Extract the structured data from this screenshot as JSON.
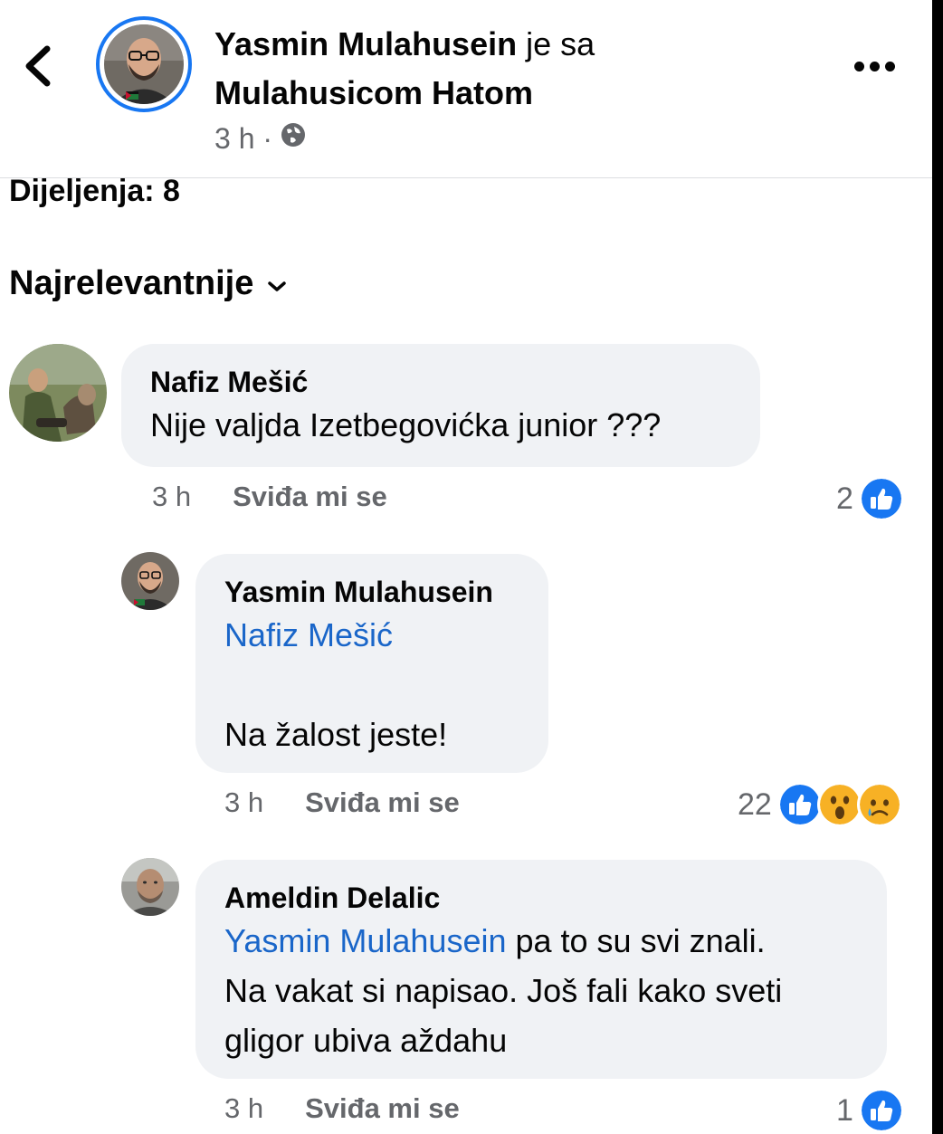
{
  "header": {
    "author": "Yasmin Mulahusein",
    "with_text": "je sa",
    "tagged": "Mulahusicom Hatom",
    "time": "3 h ·"
  },
  "shares_label": "Dijeljenja: 8",
  "sort_label": "Najrelevantnije",
  "comments": [
    {
      "author": "Nafiz Mešić",
      "text": "Nije valjda Izetbegovićka junior ???",
      "time": "3 h",
      "like_label": "Sviđa mi se",
      "reaction_count": "2",
      "reactions": [
        "like-icon"
      ]
    },
    {
      "author": "Yasmin Mulahusein",
      "mention": "Nafiz Mešić",
      "text": "Na žalost jeste!",
      "time": "3 h",
      "like_label": "Sviđa mi se",
      "reaction_count": "22",
      "reactions": [
        "like-icon",
        "wow-icon",
        "sad-icon"
      ]
    },
    {
      "author": "Ameldin Delalic",
      "mention": "Yasmin Mulahusein",
      "text_line1": " pa to su svi znali.",
      "text_line2": "Na vakat si napisao. Još fali kako sveti",
      "text_line3": "gligor ubiva aždahu",
      "time": "3 h",
      "like_label": "Sviđa mi se",
      "reaction_count": "1",
      "reactions": [
        "like-icon"
      ]
    }
  ],
  "colors": {
    "accent": "#1877f2",
    "mention": "#1a66c9",
    "bubble": "#f0f2f5",
    "muted": "#65676b"
  }
}
